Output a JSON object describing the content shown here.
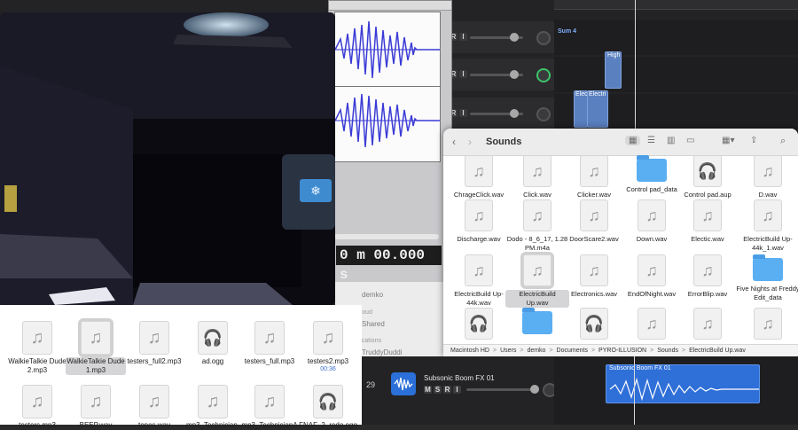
{
  "daw": {
    "tracks": [
      {
        "r": "R",
        "i": "I"
      },
      {
        "r": "R",
        "i": "I"
      },
      {
        "r": "R",
        "i": "I"
      }
    ],
    "summing_label": "Sum 4",
    "regions": [
      {
        "label": "High"
      },
      {
        "label": "Elec"
      },
      {
        "label": "Electri"
      }
    ],
    "bottom_track": {
      "number": "29",
      "name": "Subsonic Boom FX 01",
      "buttons": [
        "M",
        "S",
        "R",
        "I"
      ],
      "region_label": "Subsonic Boom FX 01"
    }
  },
  "audacity": {
    "time_display": "0 m 00.000 s"
  },
  "sidebar": {
    "items": [
      "demko"
    ],
    "icloud_header": "iCloud",
    "icloud_items": [
      "Shared"
    ],
    "locations_header": "Locations",
    "location_items": [
      "TruddyDuddi"
    ]
  },
  "finder_left": {
    "row1": [
      {
        "label": "WalkieTalkie Dude 2.mp3",
        "kind": "audio",
        "selected": false
      },
      {
        "label": "WalkieTalkie Dude 1.mp3",
        "kind": "audio",
        "selected": true
      },
      {
        "label": "testers_full2.mp3",
        "kind": "audio",
        "selected": false
      },
      {
        "label": "ad.ogg",
        "kind": "ogg",
        "selected": false
      },
      {
        "label": "testers_full.mp3",
        "kind": "audio",
        "selected": false
      },
      {
        "label": "testers2.mp3",
        "kind": "audio",
        "selected": false,
        "sub": "00:36"
      }
    ],
    "row2": [
      {
        "label": "testers.mp3",
        "kind": "audio"
      },
      {
        "label": "BEEP.wav",
        "kind": "audio"
      },
      {
        "label": "tones.wav",
        "kind": "audio"
      },
      {
        "label": "mp3_Technician.",
        "kind": "audio"
      },
      {
        "label": "mp3_TechnicianA",
        "kind": "audio"
      },
      {
        "label": "FNAF_2_redo.ogg",
        "kind": "ogg"
      }
    ]
  },
  "finder_sounds": {
    "title": "Sounds",
    "back_icon": "chevron-left-icon",
    "forward_icon": "chevron-right-icon",
    "rows": [
      [
        {
          "label": "ChrageClick.wav",
          "kind": "audio"
        },
        {
          "label": "Click.wav",
          "kind": "audio"
        },
        {
          "label": "Clicker.wav",
          "kind": "audio"
        },
        {
          "label": "Control pad_data",
          "kind": "folder"
        },
        {
          "label": "Control pad.aup",
          "kind": "aup"
        },
        {
          "label": "D.wav",
          "kind": "audio"
        }
      ],
      [
        {
          "label": "Discharge.wav",
          "kind": "audio"
        },
        {
          "label": "Dodo - 8_6_17, 1.28 PM.m4a",
          "kind": "audio"
        },
        {
          "label": "DoorScare2.wav",
          "kind": "audio"
        },
        {
          "label": "Down.wav",
          "kind": "audio"
        },
        {
          "label": "Electic.wav",
          "kind": "audio"
        },
        {
          "label": "ElectricBuild Up-44k_1.wav",
          "kind": "audio"
        }
      ],
      [
        {
          "label": "ElectricBuild Up-44k.wav",
          "kind": "audio"
        },
        {
          "label": "ElectricBuild Up.wav",
          "kind": "audio",
          "selected": true
        },
        {
          "label": "Electronics.wav",
          "kind": "audio"
        },
        {
          "label": "EndOfNight.wav",
          "kind": "audio"
        },
        {
          "label": "ErrorBlip.wav",
          "kind": "audio"
        },
        {
          "label": "Five Nights at Freddy Edit_data",
          "kind": "folder"
        }
      ],
      [
        {
          "label": "",
          "kind": "aup"
        },
        {
          "label": "",
          "kind": "folder"
        },
        {
          "label": "",
          "kind": "aup"
        },
        {
          "label": "",
          "kind": "audio"
        },
        {
          "label": "",
          "kind": "audio"
        },
        {
          "label": "",
          "kind": "audio"
        }
      ]
    ],
    "path": [
      "Macintosh HD",
      "Users",
      "demko",
      "Documents",
      "PYRO-ILLUSION",
      "Sounds",
      "ElectricBuild Up.wav"
    ],
    "path_separator": ">"
  },
  "colors": {
    "region_blue": "#5a80c0",
    "waveform_blue": "#3b3bd6",
    "finder_selection": "#d5d5d8",
    "folder_blue": "#5aaef2"
  }
}
